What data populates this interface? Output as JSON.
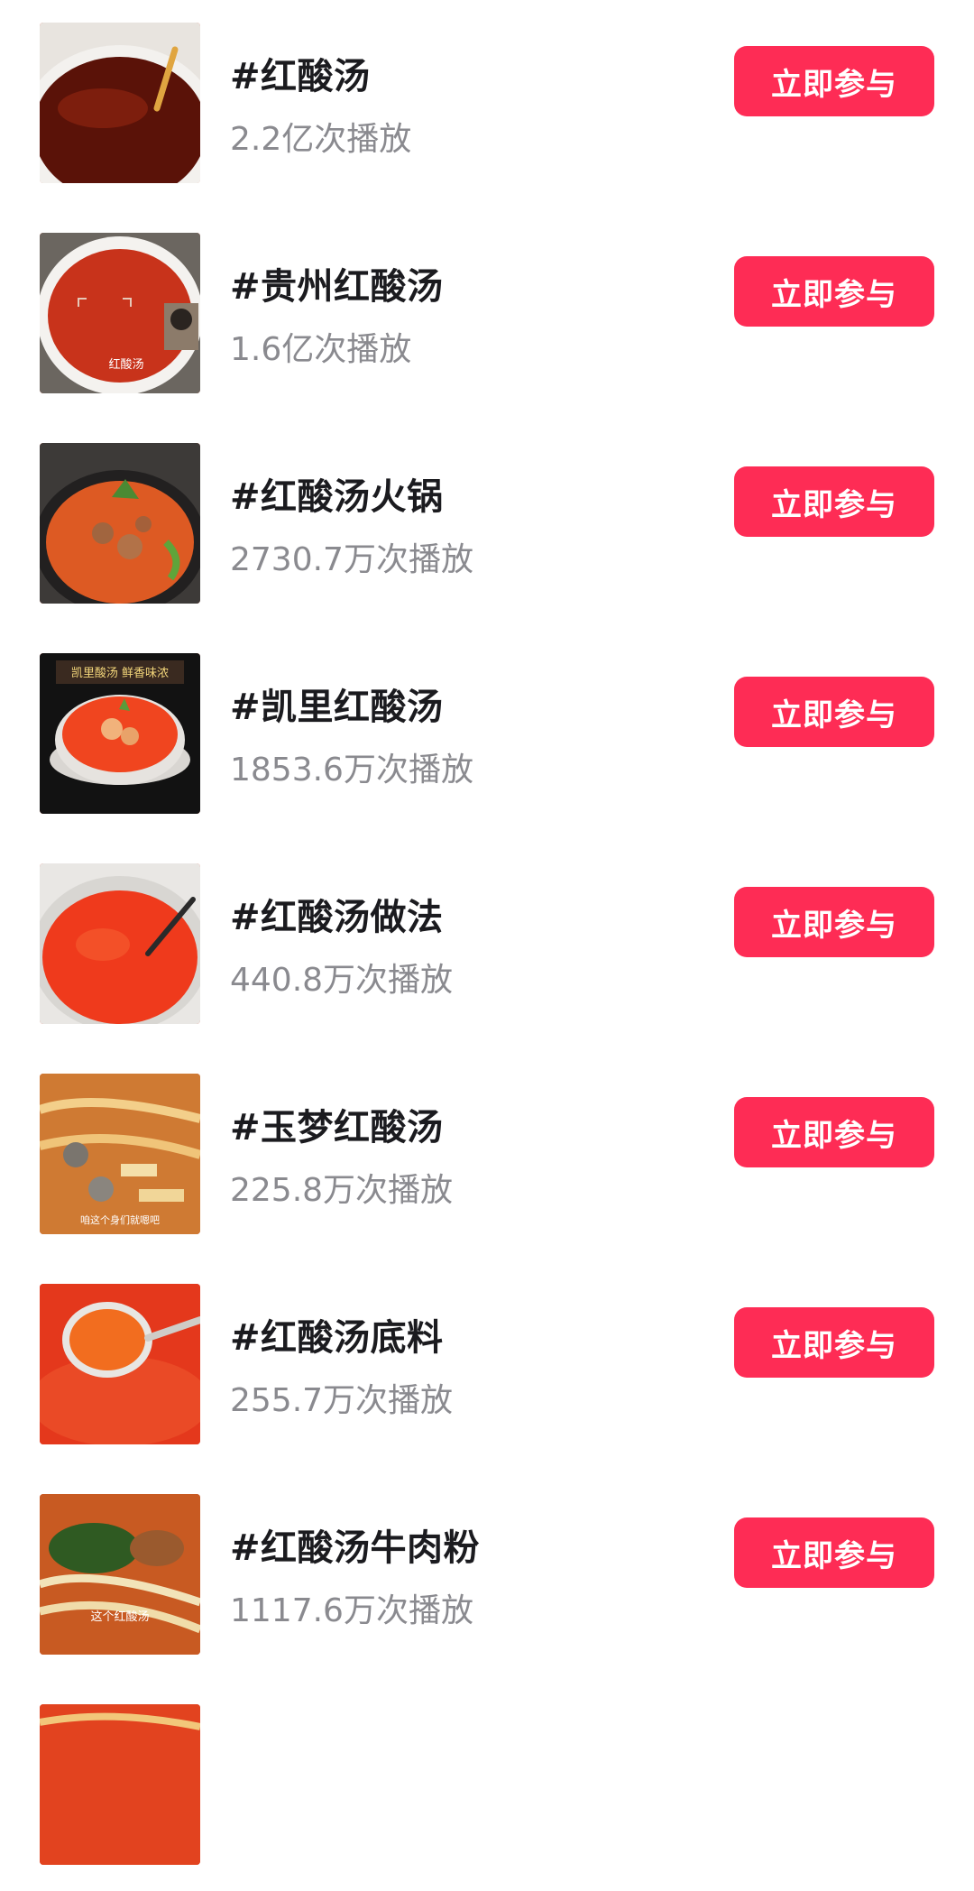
{
  "topics": [
    {
      "title": "#红酸汤",
      "views": "2.2亿次播放",
      "button": "立即参与",
      "thumb_text": ""
    },
    {
      "title": "#贵州红酸汤",
      "views": "1.6亿次播放",
      "button": "立即参与",
      "thumb_text": "红酸汤"
    },
    {
      "title": "#红酸汤火锅",
      "views": "2730.7万次播放",
      "button": "立即参与",
      "thumb_text": ""
    },
    {
      "title": "#凯里红酸汤",
      "views": "1853.6万次播放",
      "button": "立即参与",
      "thumb_text": "凯里酸汤 鲜香味浓"
    },
    {
      "title": "#红酸汤做法",
      "views": "440.8万次播放",
      "button": "立即参与",
      "thumb_text": ""
    },
    {
      "title": "#玉梦红酸汤",
      "views": "225.8万次播放",
      "button": "立即参与",
      "thumb_text": "咱这个身们就嗯吧"
    },
    {
      "title": "#红酸汤底料",
      "views": "255.7万次播放",
      "button": "立即参与",
      "thumb_text": ""
    },
    {
      "title": "#红酸汤牛肉粉",
      "views": "1117.6万次播放",
      "button": "立即参与",
      "thumb_text": "这个红酸汤"
    }
  ]
}
